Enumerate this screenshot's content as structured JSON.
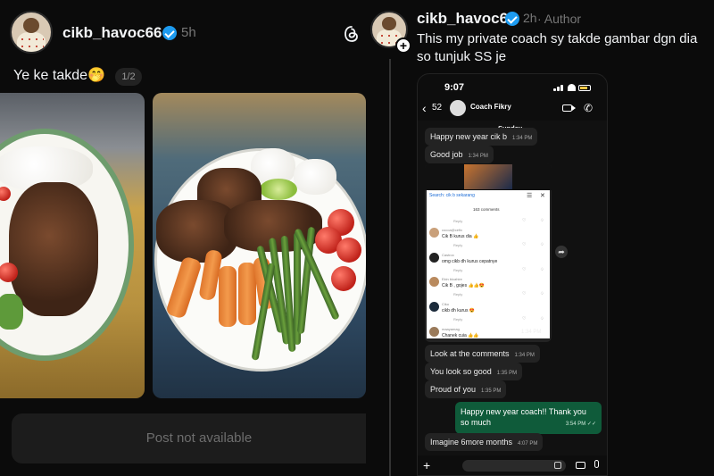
{
  "left_post": {
    "username": "cikb_havoc66",
    "time": "5h",
    "text": "Ye ke takde🤭",
    "carousel_counter": "1/2",
    "unavailable_text": "Post not available"
  },
  "right_post": {
    "username": "cikb_havoc66",
    "time": "2h",
    "author_label": "· Author",
    "text": "This my private coach sy takde gambar dgn dia so tunjuk SS je"
  },
  "phone": {
    "status_time": "9:07",
    "back_count": "52",
    "contact_name": "Coach Fikry",
    "day_label": "Sunday",
    "messages": [
      {
        "text": "Happy new year cik b",
        "time": "1:34 PM"
      },
      {
        "text": "Good job",
        "time": "1:34 PM"
      },
      {
        "text": "Look at the comments",
        "time": "1:34 PM"
      },
      {
        "text": "You look so good",
        "time": "1:35 PM"
      },
      {
        "text": "Proud of you",
        "time": "1:35 PM"
      },
      {
        "text": "Happy new year coach!! Thank you so much",
        "time": "3:54 PM ✓✓"
      },
      {
        "text": "Imagine 6more months",
        "time": "4:07 PM"
      }
    ],
    "shared": {
      "search_text": "Search: cik b sekarang",
      "comment_count": "163 comments",
      "shared_time": "1:34 PM",
      "comments": [
        {
          "user": "",
          "text": "",
          "reply": "Reply"
        },
        {
          "user": "cocoa@cefix",
          "text": "Cik B kurus dia 👍",
          "reply": "Reply"
        },
        {
          "user": "Castrox",
          "text": "omg cikb dh kurus cepatnye",
          "reply": "Reply"
        },
        {
          "user": "Ekin bicahire",
          "text": "Cik B , gojes 👍👍😍",
          "reply": "Reply"
        },
        {
          "user": "Ciko",
          "text": "cikb dh kurus 😍",
          "reply": "Reply"
        },
        {
          "user": "maayamag",
          "text": "Chanek cuia 👍👍",
          "reply": ""
        }
      ]
    }
  },
  "colors": {
    "background": "#0b0b0b",
    "verified": "#1d9bf0",
    "outgoing_bubble": "#0f5b3a",
    "incoming_bubble": "#232323"
  }
}
